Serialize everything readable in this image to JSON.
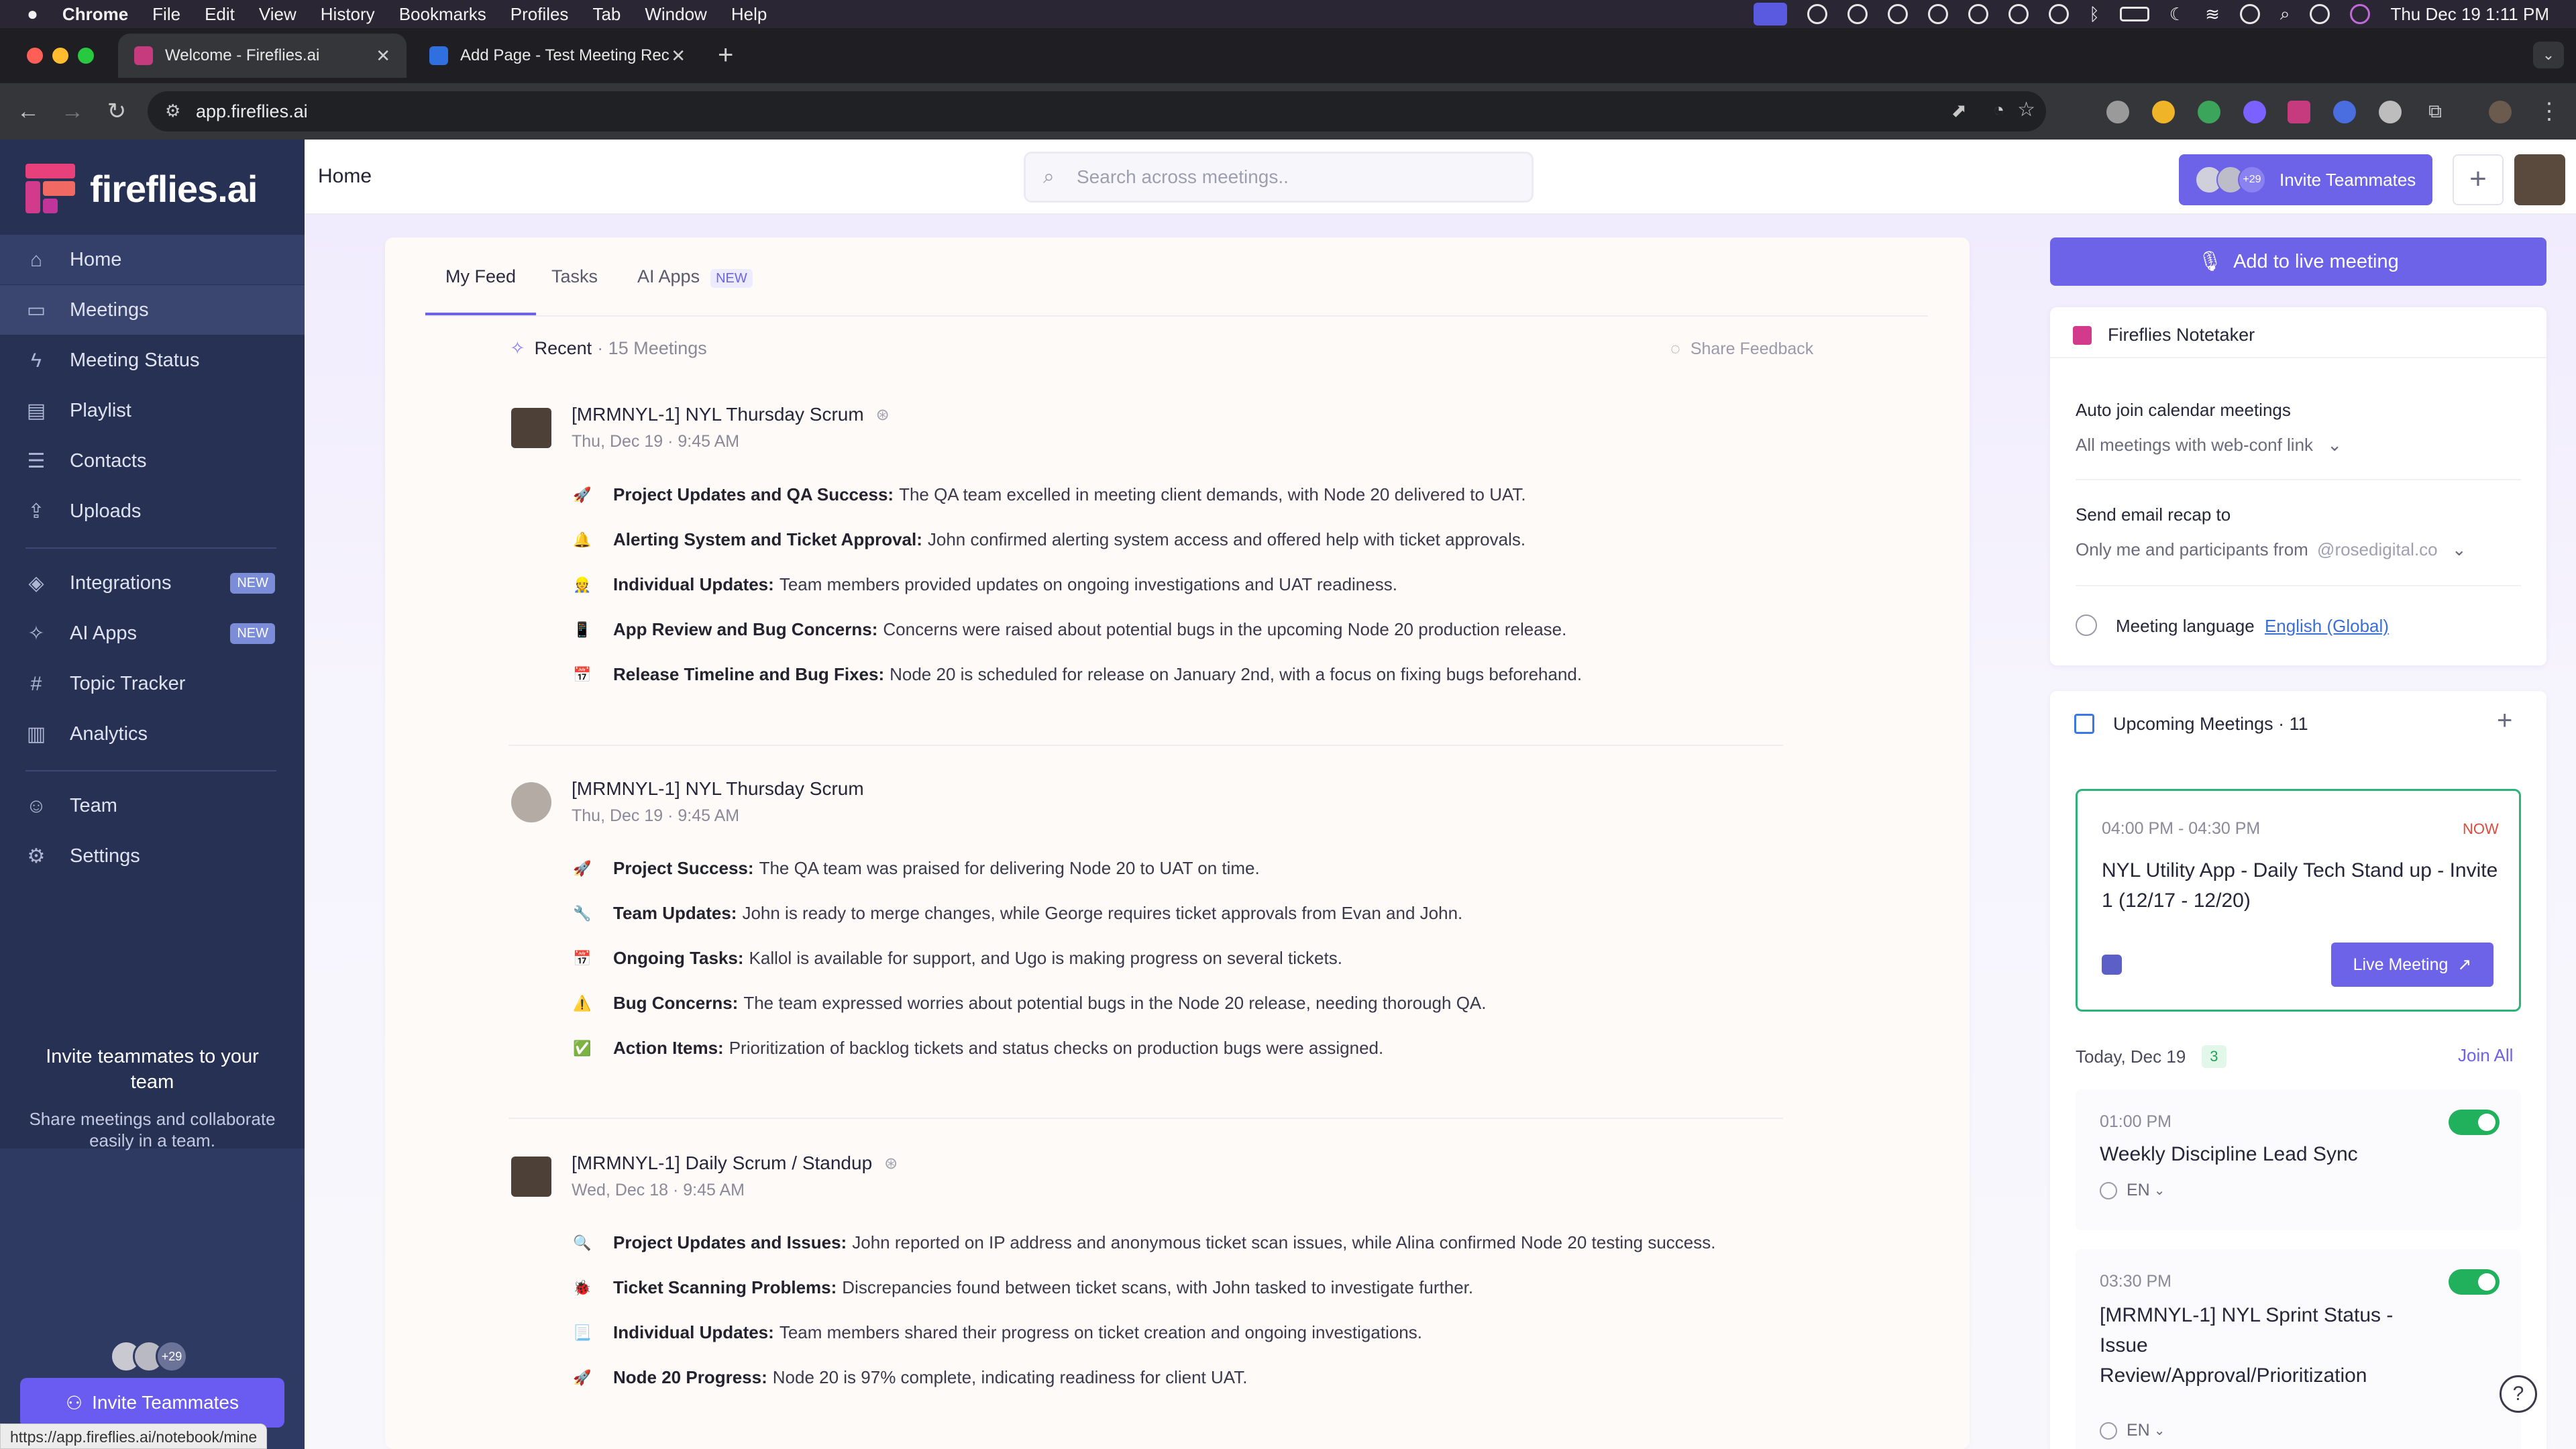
{
  "menubar": {
    "app": "Chrome",
    "items": [
      "File",
      "Edit",
      "View",
      "History",
      "Bookmarks",
      "Profiles",
      "Tab",
      "Window",
      "Help"
    ],
    "clock": "Thu Dec 19  1:11 PM"
  },
  "browser": {
    "tabs": [
      {
        "title": "Welcome - Fireflies.ai",
        "active": true
      },
      {
        "title": "Add Page - Test Meeting Rec",
        "active": false
      }
    ],
    "url": "app.fireflies.ai",
    "status_url": "https://app.fireflies.ai/notebook/mine"
  },
  "sidebar": {
    "brand": "fireflies.ai",
    "items": [
      {
        "label": "Home",
        "icon": "home-icon"
      },
      {
        "label": "Meetings",
        "icon": "video-icon"
      },
      {
        "label": "Meeting Status",
        "icon": "bolt-icon"
      },
      {
        "label": "Playlist",
        "icon": "playlist-icon"
      },
      {
        "label": "Contacts",
        "icon": "contacts-icon"
      },
      {
        "label": "Uploads",
        "icon": "upload-icon"
      },
      {
        "label": "Integrations",
        "icon": "layers-icon",
        "badge": "NEW"
      },
      {
        "label": "AI Apps",
        "icon": "sparkle-icon",
        "badge": "NEW"
      },
      {
        "label": "Topic Tracker",
        "icon": "hash-icon"
      },
      {
        "label": "Analytics",
        "icon": "chart-icon"
      },
      {
        "label": "Team",
        "icon": "team-icon"
      },
      {
        "label": "Settings",
        "icon": "gear-icon"
      }
    ],
    "invite": {
      "count": "+29",
      "title": "Invite teammates to your team",
      "subtitle": "Share meetings and collaborate easily in a team.",
      "button": "Invite Teammates"
    }
  },
  "header": {
    "title": "Home",
    "search_placeholder": "Search across meetings..",
    "invite_count": "+29",
    "invite_label": "Invite Teammates",
    "plus": "+"
  },
  "feed": {
    "tabs": [
      "My Feed",
      "Tasks",
      "AI Apps"
    ],
    "ai_apps_badge": "NEW",
    "recent_label": "Recent",
    "recent_count": "· 15 Meetings",
    "share_feedback": "Share Feedback",
    "meetings": [
      {
        "title": "[MRMNYL-1] NYL Thursday Scrum",
        "date": "Thu, Dec 19 · 9:45 AM",
        "bullets": [
          {
            "emoji": "🚀",
            "title": "Project Updates and QA Success:",
            "text": "The QA team excelled in meeting client demands, with Node 20 delivered to UAT."
          },
          {
            "emoji": "🔔",
            "title": "Alerting System and Ticket Approval:",
            "text": "John confirmed alerting system access and offered help with ticket approvals."
          },
          {
            "emoji": "👷",
            "title": "Individual Updates:",
            "text": "Team members provided updates on ongoing investigations and UAT readiness."
          },
          {
            "emoji": "📱",
            "title": "App Review and Bug Concerns:",
            "text": "Concerns were raised about potential bugs in the upcoming Node 20 production release."
          },
          {
            "emoji": "📅",
            "title": "Release Timeline and Bug Fixes:",
            "text": "Node 20 is scheduled for release on January 2nd, with a focus on fixing bugs beforehand."
          }
        ]
      },
      {
        "title": "[MRMNYL-1] NYL Thursday Scrum",
        "date": "Thu, Dec 19 · 9:45 AM",
        "bullets": [
          {
            "emoji": "🚀",
            "title": "Project Success:",
            "text": "The QA team was praised for delivering Node 20 to UAT on time."
          },
          {
            "emoji": "🔧",
            "title": "Team Updates:",
            "text": "John is ready to merge changes, while George requires ticket approvals from Evan and John."
          },
          {
            "emoji": "📅",
            "title": "Ongoing Tasks:",
            "text": "Kallol is available for support, and Ugo is making progress on several tickets."
          },
          {
            "emoji": "⚠️",
            "title": "Bug Concerns:",
            "text": "The team expressed worries about potential bugs in the Node 20 release, needing thorough QA."
          },
          {
            "emoji": "✅",
            "title": "Action Items:",
            "text": "Prioritization of backlog tickets and status checks on production bugs were assigned."
          }
        ]
      },
      {
        "title": "[MRMNYL-1] Daily Scrum / Standup",
        "date": "Wed, Dec 18 · 9:45 AM",
        "bullets": [
          {
            "emoji": "🔍",
            "title": "Project Updates and Issues:",
            "text": "John reported on IP address and anonymous ticket scan issues, while Alina confirmed Node 20 testing success."
          },
          {
            "emoji": "🐞",
            "title": "Ticket Scanning Problems:",
            "text": "Discrepancies found between ticket scans, with John tasked to investigate further."
          },
          {
            "emoji": "📃",
            "title": "Individual Updates:",
            "text": "Team members shared their progress on ticket creation and ongoing investigations."
          },
          {
            "emoji": "🚀",
            "title": "Node 20 Progress:",
            "text": "Node 20 is 97% complete, indicating readiness for client UAT."
          }
        ]
      }
    ]
  },
  "right": {
    "live_button": "Add to live meeting",
    "notetaker": {
      "title": "Fireflies Notetaker",
      "auto_join_label": "Auto join calendar meetings",
      "auto_join_value": "All meetings with web-conf link",
      "recap_label": "Send email recap to",
      "recap_value": "Only me and participants from",
      "recap_domain": "@rosedigital.co",
      "language_label": "Meeting language",
      "language_value": "English (Global)"
    },
    "upcoming": {
      "title": "Upcoming Meetings · 11",
      "now_card": {
        "time": "04:00 PM - 04:30 PM",
        "now": "NOW",
        "title": "NYL Utility App - Daily Tech Stand up - Invite 1 (12/17 - 12/20)",
        "button": "Live Meeting"
      },
      "today_label": "Today, Dec 19",
      "today_count": "3",
      "join_all": "Join All",
      "items": [
        {
          "time": "01:00 PM",
          "title": "Weekly Discipline Lead Sync",
          "lang": "EN"
        },
        {
          "time": "03:30 PM",
          "title": "[MRMNYL-1] NYL Sprint Status - Issue Review/Approval/Prioritization",
          "lang": "EN"
        }
      ]
    },
    "help": "?"
  }
}
